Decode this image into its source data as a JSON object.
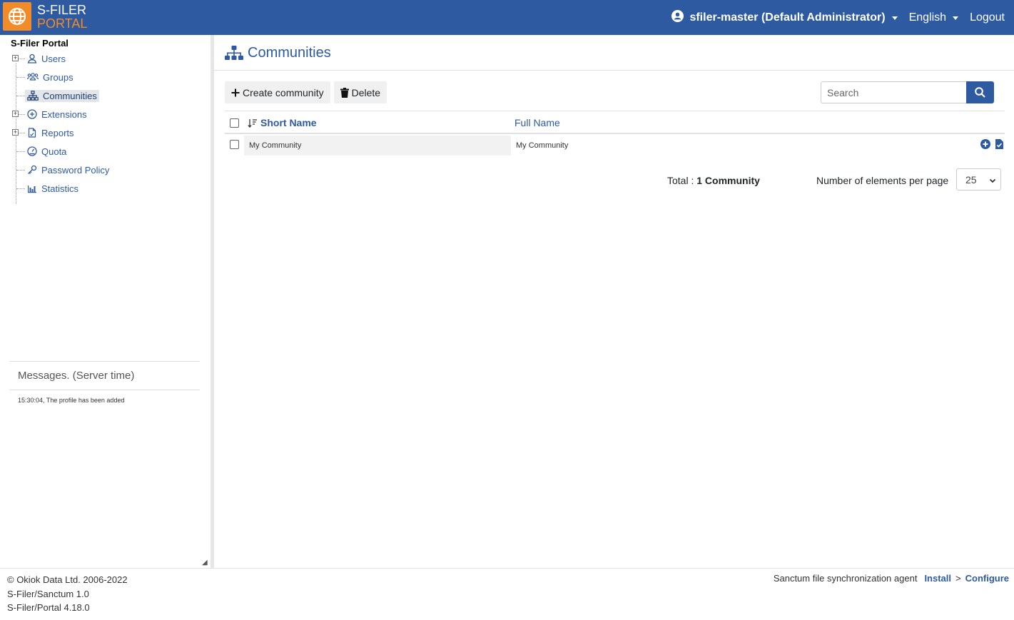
{
  "header": {
    "brand_line1": "S-FILER",
    "brand_line2": "PORTAL",
    "user": "sfiler-master (Default Administrator)",
    "language": "English",
    "logout": "Logout"
  },
  "sidebar": {
    "root": "S-Filer Portal",
    "items": [
      {
        "label": "Users",
        "icon": "user-icon",
        "expandable": true
      },
      {
        "label": "Groups",
        "icon": "groups-icon",
        "expandable": false
      },
      {
        "label": "Communities",
        "icon": "sitemap-icon",
        "expandable": false,
        "selected": true
      },
      {
        "label": "Extensions",
        "icon": "plus-circle-icon",
        "expandable": true
      },
      {
        "label": "Reports",
        "icon": "report-icon",
        "expandable": true
      },
      {
        "label": "Quota",
        "icon": "gauge-icon",
        "expandable": false
      },
      {
        "label": "Password Policy",
        "icon": "key-icon",
        "expandable": false
      },
      {
        "label": "Statistics",
        "icon": "bar-chart-icon",
        "expandable": false
      }
    ],
    "messages_title": "Messages. (Server time)",
    "messages": [
      "15:30:04, The profile has been added"
    ]
  },
  "main": {
    "title": "Communities",
    "toolbar": {
      "create": "Create community",
      "delete": "Delete"
    },
    "search_placeholder": "Search",
    "table": {
      "columns": [
        "Short Name",
        "Full Name"
      ],
      "rows": [
        {
          "short_name": "My Community",
          "full_name": "My Community"
        }
      ]
    },
    "total_label": "Total :",
    "total_value": "1 Community",
    "per_page_label": "Number of elements per page",
    "per_page_value": "25"
  },
  "footer": {
    "copyright": "© Okiok Data Ltd. 2006-2022",
    "version1": "S-Filer/Sanctum 1.0",
    "version2": "S-Filer/Portal 4.18.0",
    "agent_label": "Sanctum file synchronization agent",
    "install": "Install",
    "separator": ">",
    "configure": "Configure"
  },
  "colors": {
    "primary": "#2d5aa0",
    "accent": "#f28c28"
  }
}
